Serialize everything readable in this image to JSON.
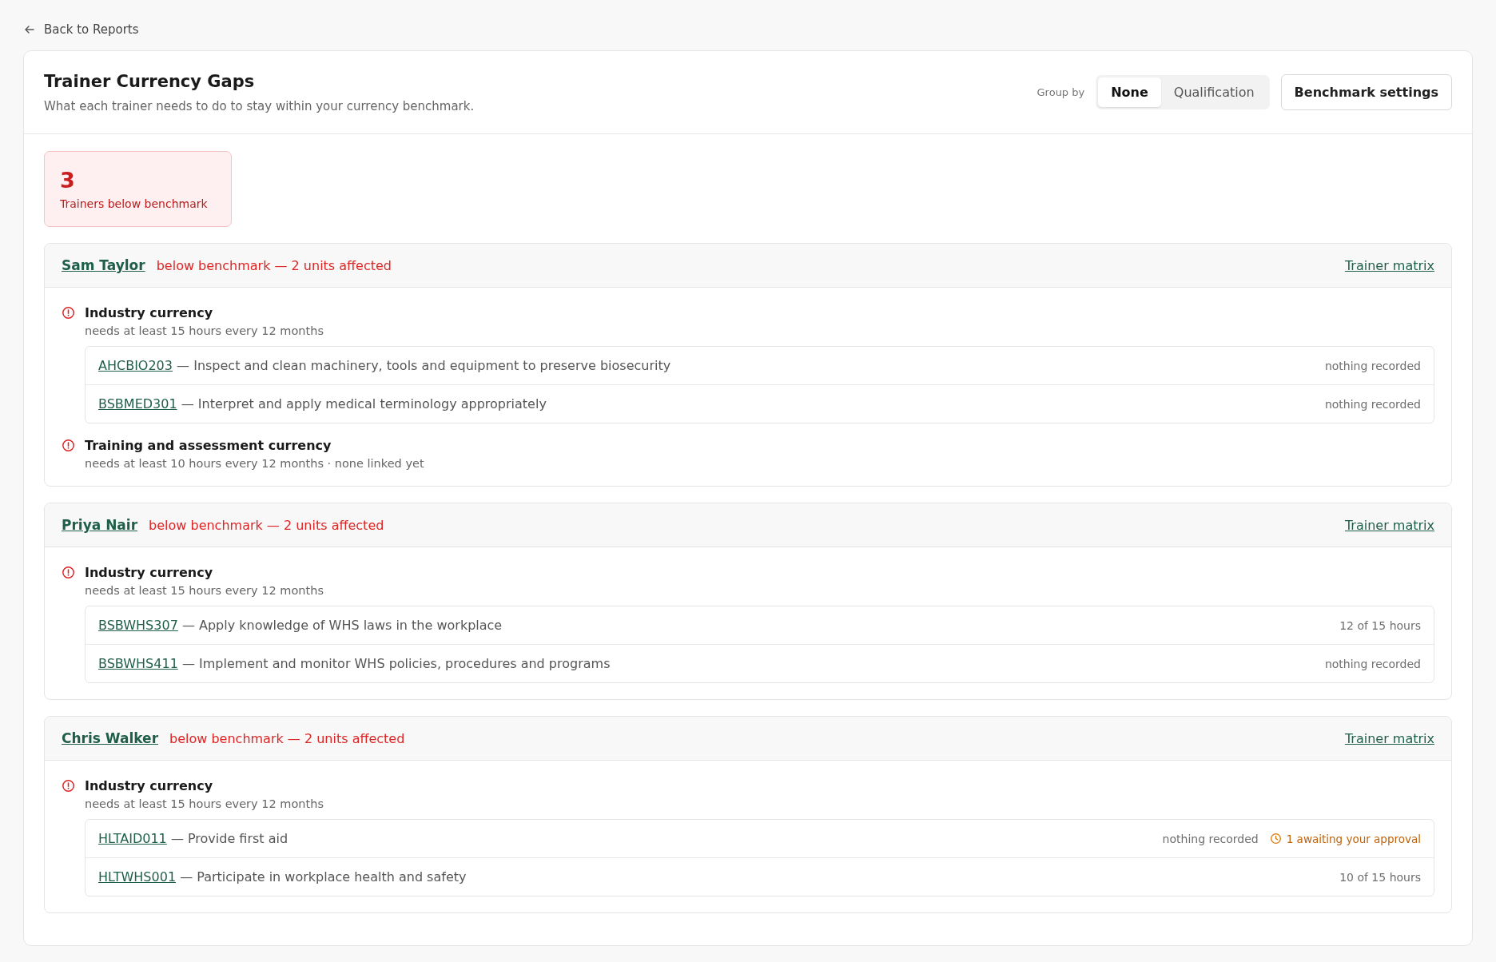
{
  "back_link": {
    "label": "Back to Reports"
  },
  "header": {
    "title": "Trainer Currency Gaps",
    "subtitle": "What each trainer needs to do to stay within your currency benchmark.",
    "group_by_label": "Group by",
    "group_options": [
      {
        "label": "None",
        "selected": true
      },
      {
        "label": "Qualification",
        "selected": false
      }
    ],
    "settings_button": "Benchmark settings"
  },
  "summary": {
    "count": "3",
    "label": "Trainers below benchmark"
  },
  "trainers": [
    {
      "name": "Sam Taylor",
      "status": "below benchmark — 2 units affected",
      "matrix_link": "Trainer matrix",
      "requirements": [
        {
          "title": "Industry currency",
          "detail": "needs at least 15 hours every 12 months",
          "units": [
            {
              "code": "AHCBIO203",
              "description": "— Inspect and clean machinery, tools and equipment to preserve biosecurity",
              "progress": "nothing recorded"
            },
            {
              "code": "BSBMED301",
              "description": "— Interpret and apply medical terminology appropriately",
              "progress": "nothing recorded"
            }
          ]
        },
        {
          "title": "Training and assessment currency",
          "detail": "needs at least 10 hours every 12 months · none linked yet"
        }
      ]
    },
    {
      "name": "Priya Nair",
      "status": "below benchmark — 2 units affected",
      "matrix_link": "Trainer matrix",
      "requirements": [
        {
          "title": "Industry currency",
          "detail": "needs at least 15 hours every 12 months",
          "units": [
            {
              "code": "BSBWHS307",
              "description": "— Apply knowledge of WHS laws in the workplace",
              "progress": "12 of 15 hours"
            },
            {
              "code": "BSBWHS411",
              "description": "— Implement and monitor WHS policies, procedures and programs",
              "progress": "nothing recorded"
            }
          ]
        }
      ]
    },
    {
      "name": "Chris Walker",
      "status": "below benchmark — 2 units affected",
      "matrix_link": "Trainer matrix",
      "requirements": [
        {
          "title": "Industry currency",
          "detail": "needs at least 15 hours every 12 months",
          "units": [
            {
              "code": "HLTAID011",
              "description": "— Provide first aid",
              "progress": "nothing recorded",
              "pending": "1 awaiting your approval"
            },
            {
              "code": "HLTWHS001",
              "description": "— Participate in workplace health and safety",
              "progress": "10 of 15 hours"
            }
          ]
        }
      ]
    }
  ]
}
